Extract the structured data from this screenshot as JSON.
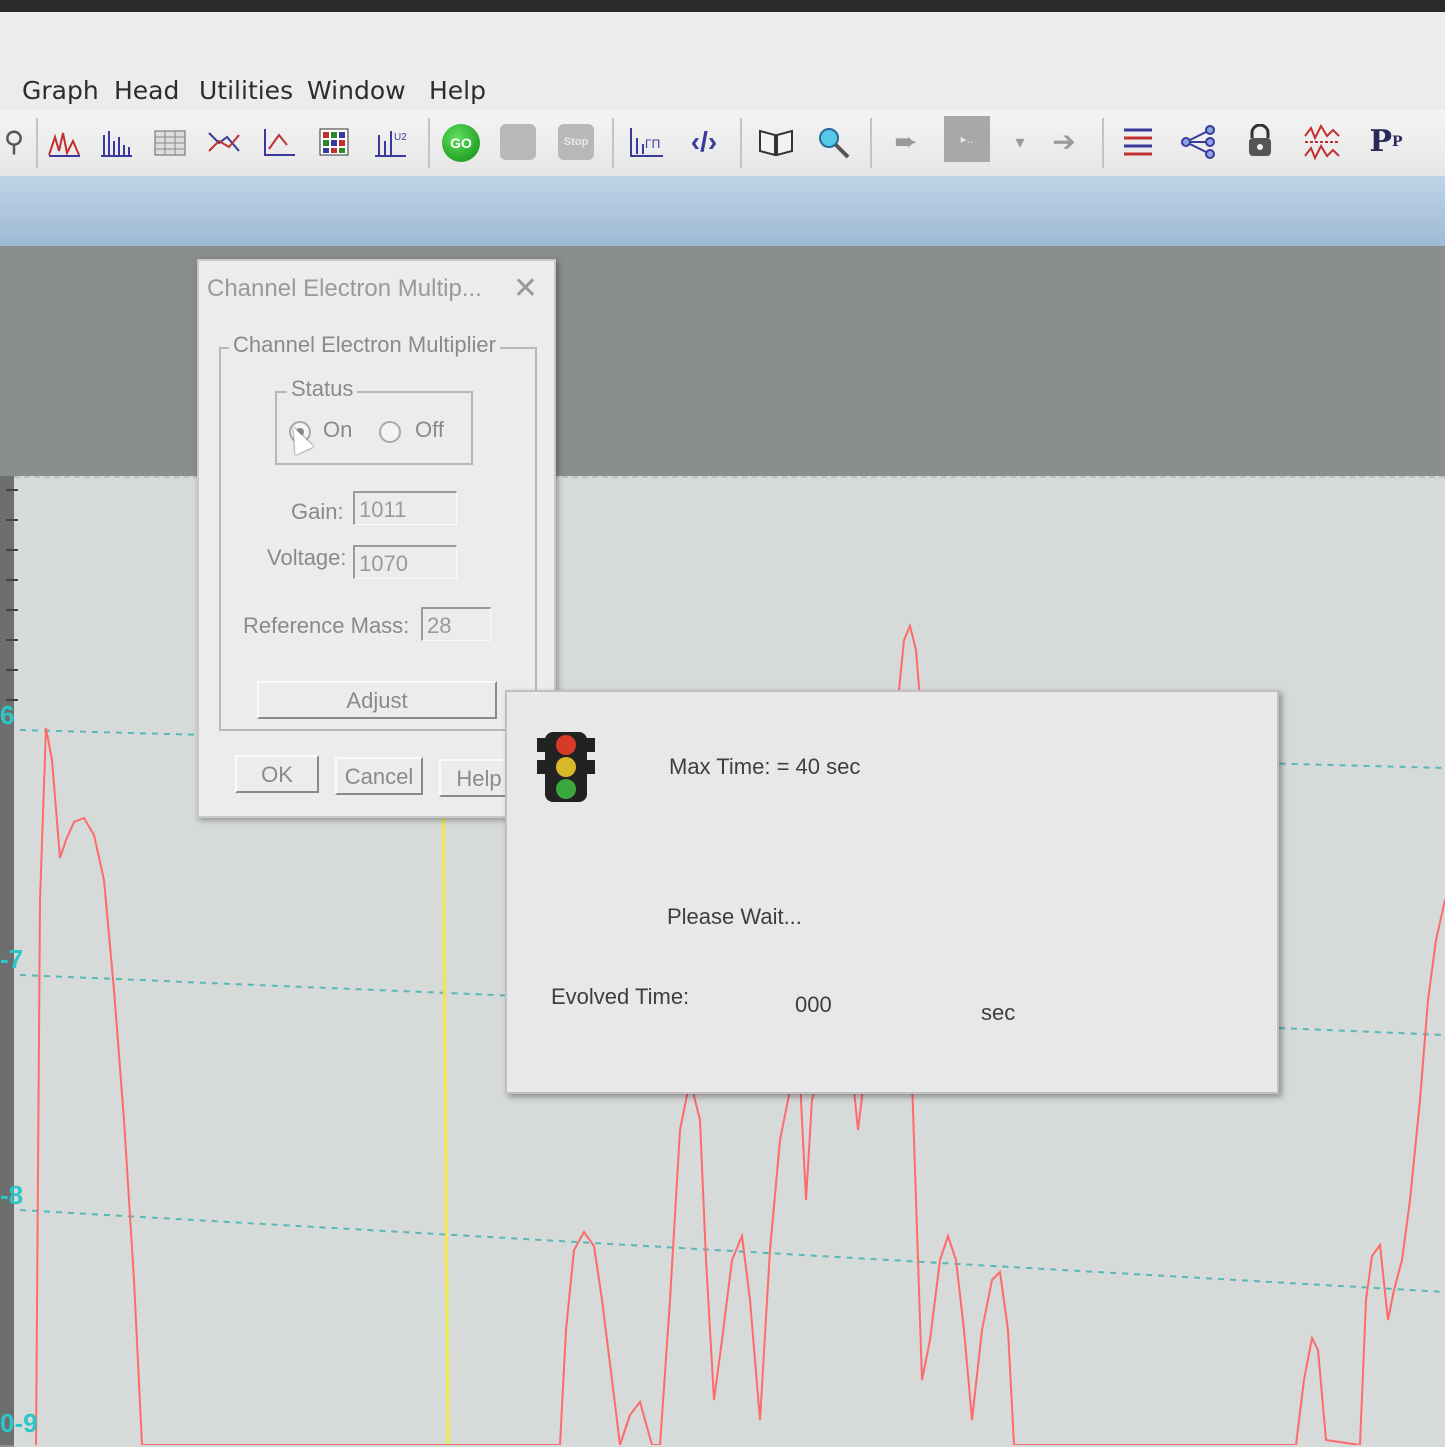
{
  "menu": [
    "Graph",
    "Head",
    "Utilities",
    "Window",
    "Help"
  ],
  "toolbar": {
    "icons": [
      "zoom-icon",
      "analog-scan-icon",
      "bar-chart-icon",
      "table-icon",
      "trend-icon",
      "leak-check-icon",
      "grid-icon",
      "multi-ion-icon",
      "go-icon",
      "stop-square-icon",
      "stop-icon",
      "library-icon",
      "code-icon",
      "book-icon",
      "search-icon",
      "back-arrow-icon",
      "preview-icon",
      "dropdown-icon",
      "forward-arrow-icon",
      "tune-icon",
      "network-icon",
      "lock-icon",
      "peak-icon",
      "pp-icon"
    ],
    "go_label": "GO",
    "stop_label": "Stop"
  },
  "y_axis_labels": [
    "6",
    "-7",
    "-8",
    "0-9"
  ],
  "cem_dialog": {
    "title": "Channel Electron Multip...",
    "group_title": "Channel Electron Multiplier",
    "status_label": "Status",
    "status_options": [
      "On",
      "Off"
    ],
    "status_selected": "On",
    "gain_label": "Gain:",
    "gain_value": "1011",
    "voltage_label": "Voltage:",
    "voltage_value": "1070",
    "ref_mass_label": "Reference Mass:",
    "ref_mass_value": "28",
    "adjust_label": "Adjust",
    "ok_label": "OK",
    "cancel_label": "Cancel",
    "help_label": "Help"
  },
  "wait_dialog": {
    "max_time_text": "Max Time: = 40  sec",
    "please_wait": "Please Wait...",
    "evolved_label": "Evolved Time:",
    "evolved_value": "000",
    "evolved_unit": "sec"
  },
  "colors": {
    "trace": "#ff6a6a",
    "axis_labels": "#2bc6c8",
    "cursor_line": "#f2e84a",
    "gridline": "#58b8b8"
  }
}
